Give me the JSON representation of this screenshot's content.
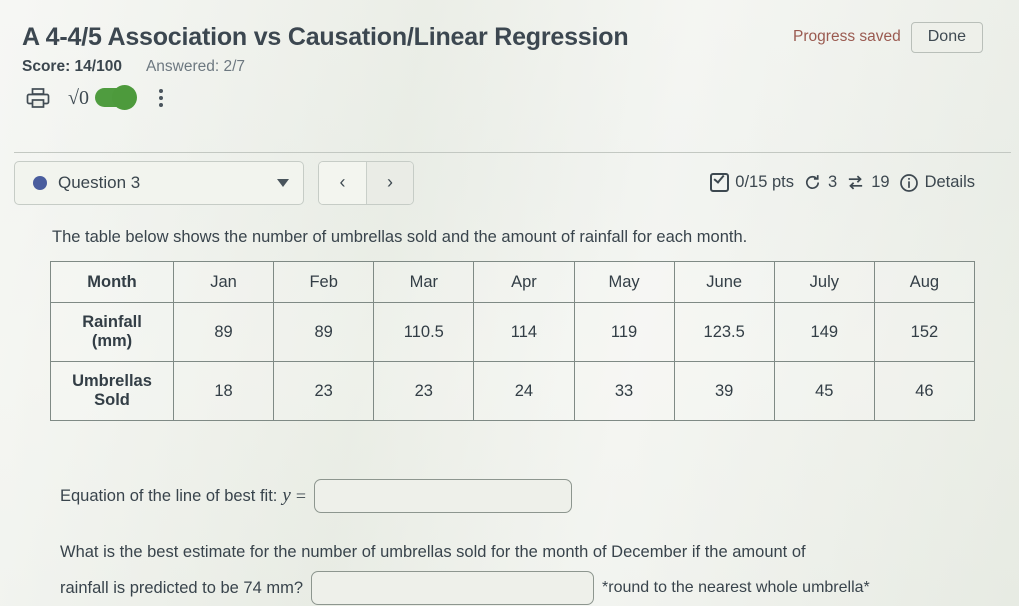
{
  "header": {
    "quiz_title": "A 4-4/5 Association vs Causation/Linear Regression",
    "progress_saved": "Progress saved",
    "done_label": "Done",
    "score": "Score: 14/100",
    "answered": "Answered: 2/7",
    "toolbar": {
      "print_icon": "print-icon",
      "sqrt_label": "√0",
      "toggle_state": "on",
      "menu_icon": "kebab-menu-icon"
    },
    "progress_saved_color": "#9a5a50"
  },
  "question_bar": {
    "question_label": "Question 3",
    "status_dot_color": "#4a5d9e",
    "prev_label": "‹",
    "next_label": "›",
    "points": "0/15 pts",
    "attempts": "3",
    "shuffles": "19",
    "details_label": "Details"
  },
  "main": {
    "prompt": "The table below shows the number of umbrellas sold and the amount of rainfall for each month.",
    "table": {
      "row_headers": [
        "Month",
        "Rainfall (mm)",
        "Umbrellas Sold"
      ],
      "months": [
        "Jan",
        "Feb",
        "Mar",
        "Apr",
        "May",
        "June",
        "July",
        "Aug"
      ],
      "rainfall": [
        "89",
        "89",
        "110.5",
        "114",
        "119",
        "123.5",
        "149",
        "152"
      ],
      "umbrellas": [
        "18",
        "23",
        "23",
        "24",
        "33",
        "39",
        "45",
        "46"
      ]
    },
    "equation_label": "Equation of the line of best fit:",
    "equation_var": "y",
    "equation_equals": "=",
    "equation_value": "",
    "question2_line1": "What is the best estimate for the number of umbrellas sold for the month of December if the amount of",
    "question2_line2": "rainfall is predicted to be 74 mm?",
    "question2_value": "",
    "question2_note": "*round to the nearest whole umbrella*"
  },
  "chart_data": {
    "type": "table",
    "title": "Umbrellas sold vs rainfall by month",
    "categories": [
      "Jan",
      "Feb",
      "Mar",
      "Apr",
      "May",
      "June",
      "July",
      "Aug"
    ],
    "series": [
      {
        "name": "Rainfall (mm)",
        "values": [
          89,
          89,
          110.5,
          114,
          119,
          123.5,
          149,
          152
        ]
      },
      {
        "name": "Umbrellas Sold",
        "values": [
          18,
          23,
          23,
          24,
          33,
          39,
          45,
          46
        ]
      }
    ],
    "xlabel": "Month",
    "ylabel": ""
  }
}
